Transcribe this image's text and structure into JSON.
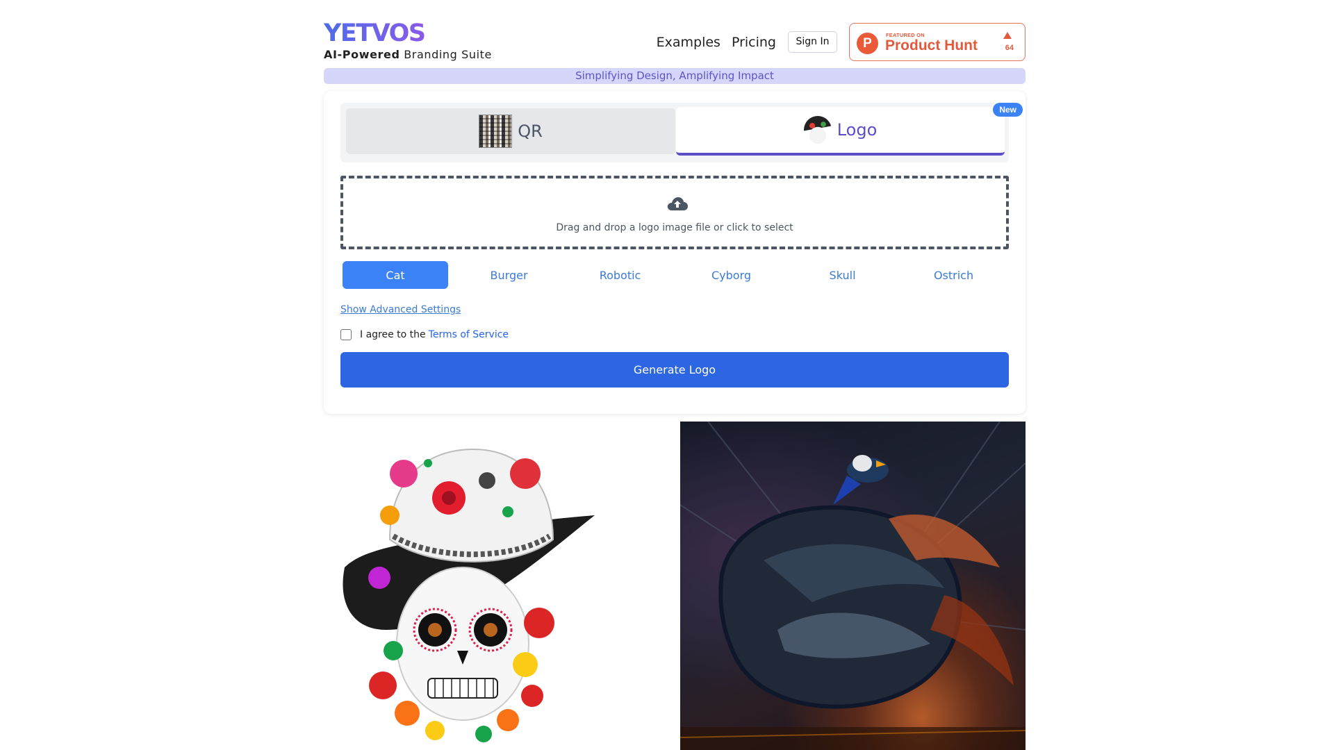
{
  "brand": {
    "name": "YETVOS",
    "tagline_bold": "AI-Powered",
    "tagline_rest": " Branding Suite"
  },
  "nav": {
    "examples": "Examples",
    "pricing": "Pricing",
    "sign_in": "Sign In"
  },
  "product_hunt": {
    "letter": "P",
    "featured": "FEATURED ON",
    "name": "Product Hunt",
    "count": "64"
  },
  "slogan": "Simplifying Design, Amplifying Impact",
  "tabs": {
    "qr_label": "QR",
    "logo_label": "Logo",
    "new_badge": "New"
  },
  "dropzone": {
    "text": "Drag and drop a logo image file or click to select"
  },
  "presets": [
    "Cat",
    "Burger",
    "Robotic",
    "Cyborg",
    "Skull",
    "Ostrich"
  ],
  "presets_selected": "Cat",
  "advanced_link": "Show Advanced Settings",
  "terms": {
    "prefix": "I agree to the",
    "link": "Terms of Service",
    "checked": false
  },
  "generate_label": "Generate Logo",
  "colors": {
    "primary": "#2d66e3",
    "accent_purple": "#5b4fc9",
    "product_hunt": "#e15a3c",
    "slogan_bg": "#d6d6fb"
  }
}
